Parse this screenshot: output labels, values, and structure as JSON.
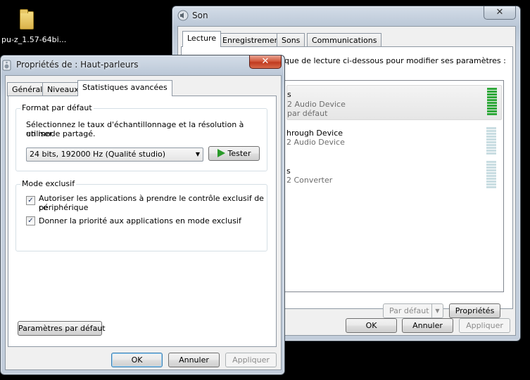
{
  "desktop": {
    "icon_label": "pu-z_1.57-64bi..."
  },
  "son": {
    "title": "Son",
    "close": "✕",
    "tabs": [
      "Lecture",
      "Enregistrement",
      "Sons",
      "Communications"
    ],
    "instruction": "que de lecture ci-dessous pour modifier ses paramètres :",
    "devices": [
      {
        "line1": "s",
        "line2": "2 Audio Device",
        "line3": "par défaut"
      },
      {
        "line1": "hrough Device",
        "line2": "2 Audio Device"
      },
      {
        "line1": "s",
        "line2": "2 Converter"
      }
    ],
    "buttons": {
      "default": "Par défaut",
      "properties": "Propriétés",
      "ok": "OK",
      "cancel": "Annuler",
      "apply": "Appliquer"
    }
  },
  "props": {
    "title": "Propriétés de : Haut-parleurs",
    "close": "✕",
    "tabs": [
      "Général",
      "Niveaux",
      "Statistiques avancées"
    ],
    "format_group": "Format par défaut",
    "format_desc_1": "Sélectionnez le taux d'échantillonnage et la résolution à utiliser",
    "format_desc_2": "en mode partagé.",
    "format_value": "24 bits, 192000 Hz (Qualité studio)",
    "test_button": "Tester",
    "exclusive_group": "Mode exclusif",
    "check1_line1": "Autoriser les applications à prendre le contrôle exclusif de ce",
    "check1_line2": "périphérique",
    "check2": "Donner la priorité aux applications en mode exclusif",
    "check_mark": "✓",
    "restore_defaults": "Paramètres par défaut",
    "buttons": {
      "ok": "OK",
      "cancel": "Annuler",
      "apply": "Appliquer"
    }
  }
}
